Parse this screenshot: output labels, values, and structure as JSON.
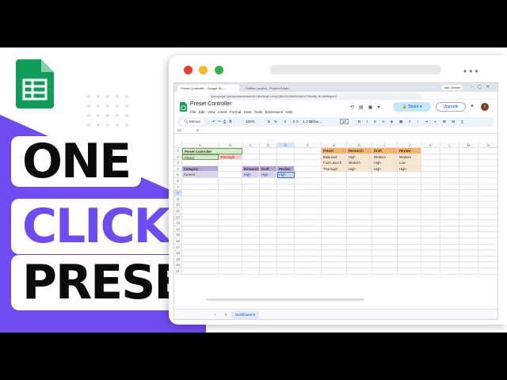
{
  "headline": {
    "line1": "ONE",
    "line2": "CLICK",
    "line3": "PRESETS"
  },
  "colors": {
    "accent": "#6f4bf2",
    "sheets_green": "#0f9d58"
  },
  "browser": {
    "tabs": [
      "Preset Controller - Google Sh...",
      "Untitled project - Project Editor..."
    ],
    "ask_gemini": "Ask Gemini",
    "url": "docs.google.com/spreadsheets/d/1K1dbsWhq8-LeNqQQ8m0Dn95aSZaNmVY2Kbz8k_5KJ/edit#gid=0"
  },
  "doc": {
    "title": "Preset Controller",
    "menu": [
      "File",
      "Edit",
      "View",
      "Insert",
      "Format",
      "Data",
      "Tools",
      "Extensions",
      "Help"
    ],
    "share": "Share",
    "upgrade": "Upgrade",
    "avatar_letter": "t"
  },
  "toolbar": {
    "menus": "Menus",
    "zoom": "100%",
    "formats": "$  %  .0  .00  123",
    "font": "Defau...",
    "font_size": "10"
  },
  "formula_bar": {
    "cell_ref": "E8",
    "fx": "fx"
  },
  "sheet": {
    "columns": [
      "A",
      "B",
      "C",
      "D",
      "E",
      "F",
      "G",
      "H",
      "I",
      "J",
      "K",
      "L",
      "M",
      "N"
    ],
    "rows": [
      "1",
      "2",
      "3",
      "4",
      "5",
      "6",
      "7",
      "8",
      "9",
      "10",
      "11",
      "12",
      "13",
      "14",
      "15",
      "16",
      "17",
      "18",
      "19",
      "20",
      "21"
    ],
    "left_block": {
      "title": "Preset Controller",
      "preset_label": "Preset",
      "preset_value": "Thorough",
      "headers": [
        "Category",
        "Research",
        "Draft",
        "Review"
      ],
      "current_label": "Current",
      "current_values": [
        "High",
        "High",
        "High"
      ]
    },
    "right_table": {
      "headers": [
        "Preset",
        "Research",
        "Draft",
        "Review"
      ],
      "rows": [
        [
          "Balanced",
          "High",
          "Medium",
          "Medium"
        ],
        [
          "Fast Launch",
          "Medium",
          "High",
          "Low"
        ],
        [
          "Thorough",
          "High",
          "High",
          "High"
        ]
      ]
    }
  },
  "sheet_tab": "Dashboard"
}
